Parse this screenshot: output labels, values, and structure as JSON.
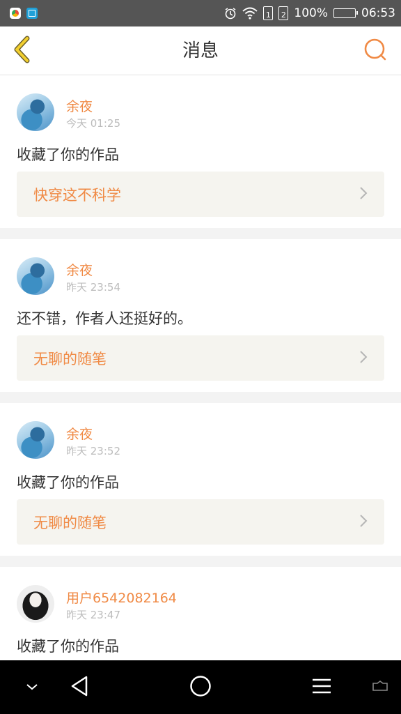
{
  "status_bar": {
    "battery": "100%",
    "time": "06:53",
    "sim1": "1",
    "sim2": "2"
  },
  "header": {
    "title": "消息",
    "accent_color": "#f08a45"
  },
  "messages": [
    {
      "user": "余夜",
      "time": "今天 01:25",
      "text": "收藏了你的作品",
      "link": "快穿这不科学",
      "avatar": "blue-anime-avatar"
    },
    {
      "user": "余夜",
      "time": "昨天 23:54",
      "text": "还不错，作者人还挺好的。",
      "link": "无聊的随笔",
      "avatar": "blue-anime-avatar"
    },
    {
      "user": "余夜",
      "time": "昨天 23:52",
      "text": "收藏了你的作品",
      "link": "无聊的随笔",
      "avatar": "blue-anime-avatar"
    },
    {
      "user": "用户6542082164",
      "time": "昨天 23:47",
      "text": "收藏了你的作品",
      "avatar": "dark-hair-avatar"
    }
  ]
}
